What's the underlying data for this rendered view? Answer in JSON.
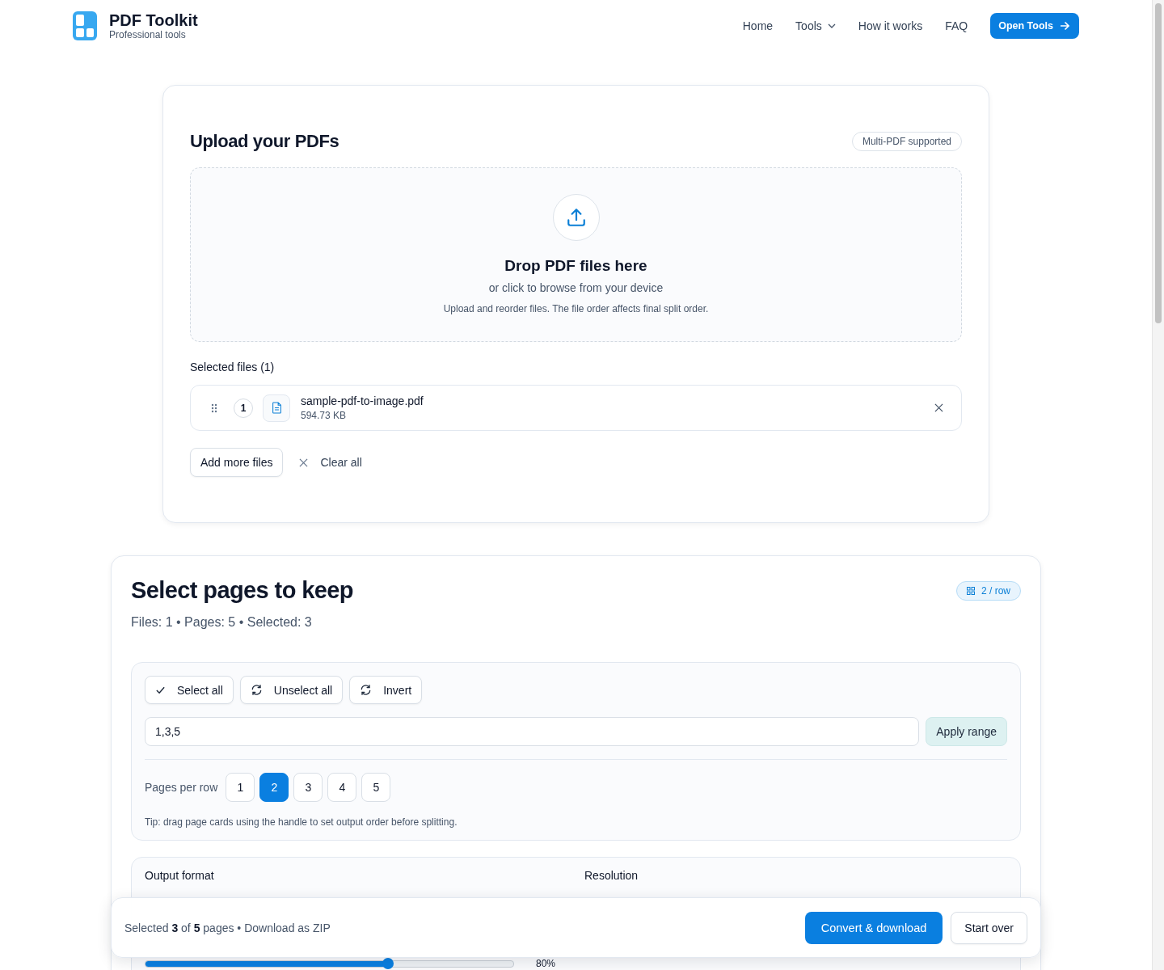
{
  "header": {
    "brand": "PDF Toolkit",
    "tagline": "Professional tools",
    "nav": [
      {
        "label": "Home",
        "dropdown": false
      },
      {
        "label": "Tools",
        "dropdown": true
      },
      {
        "label": "How it works",
        "dropdown": false
      },
      {
        "label": "FAQ",
        "dropdown": false
      }
    ],
    "cta": "Open Tools"
  },
  "upload": {
    "title": "Upload your PDFs",
    "badge": "Multi-PDF supported",
    "dropzone": {
      "title": "Drop PDF files here",
      "subtitle": "or click to browse from your device",
      "hint": "Upload and reorder files. The file order affects final split order."
    },
    "selected_label": "Selected files (1)",
    "files": [
      {
        "index": "1",
        "name": "sample-pdf-to-image.pdf",
        "size": "594.73 KB"
      }
    ],
    "add_more": "Add more files",
    "clear_all": "Clear all"
  },
  "pages": {
    "title": "Select pages to keep",
    "stats": "Files: 1 • Pages: 5 • Selected: 3",
    "layout_badge": "2 / row",
    "bulk_actions": [
      {
        "label": "Select all",
        "kind": "check"
      },
      {
        "label": "Unselect all",
        "kind": "refresh"
      },
      {
        "label": "Invert",
        "kind": "refresh"
      }
    ],
    "range_value": "1,3,5",
    "apply": "Apply range",
    "per_row_label": "Pages per row",
    "per_row": [
      {
        "label": "1",
        "selected": false
      },
      {
        "label": "2",
        "selected": true
      },
      {
        "label": "3",
        "selected": false
      },
      {
        "label": "4",
        "selected": false
      },
      {
        "label": "5",
        "selected": false
      }
    ],
    "tip": "Tip: drag page cards using the handle to set output order before splitting."
  },
  "settings": {
    "output_format_label": "Output format",
    "resolution_label": "Resolution",
    "quality": {
      "level": 0.66,
      "reading": "80%"
    }
  },
  "bottom_bar": {
    "summary": "Selected **3** of **5** pages • Download as ZIP",
    "primary": "Convert & download",
    "secondary": "Start over"
  }
}
